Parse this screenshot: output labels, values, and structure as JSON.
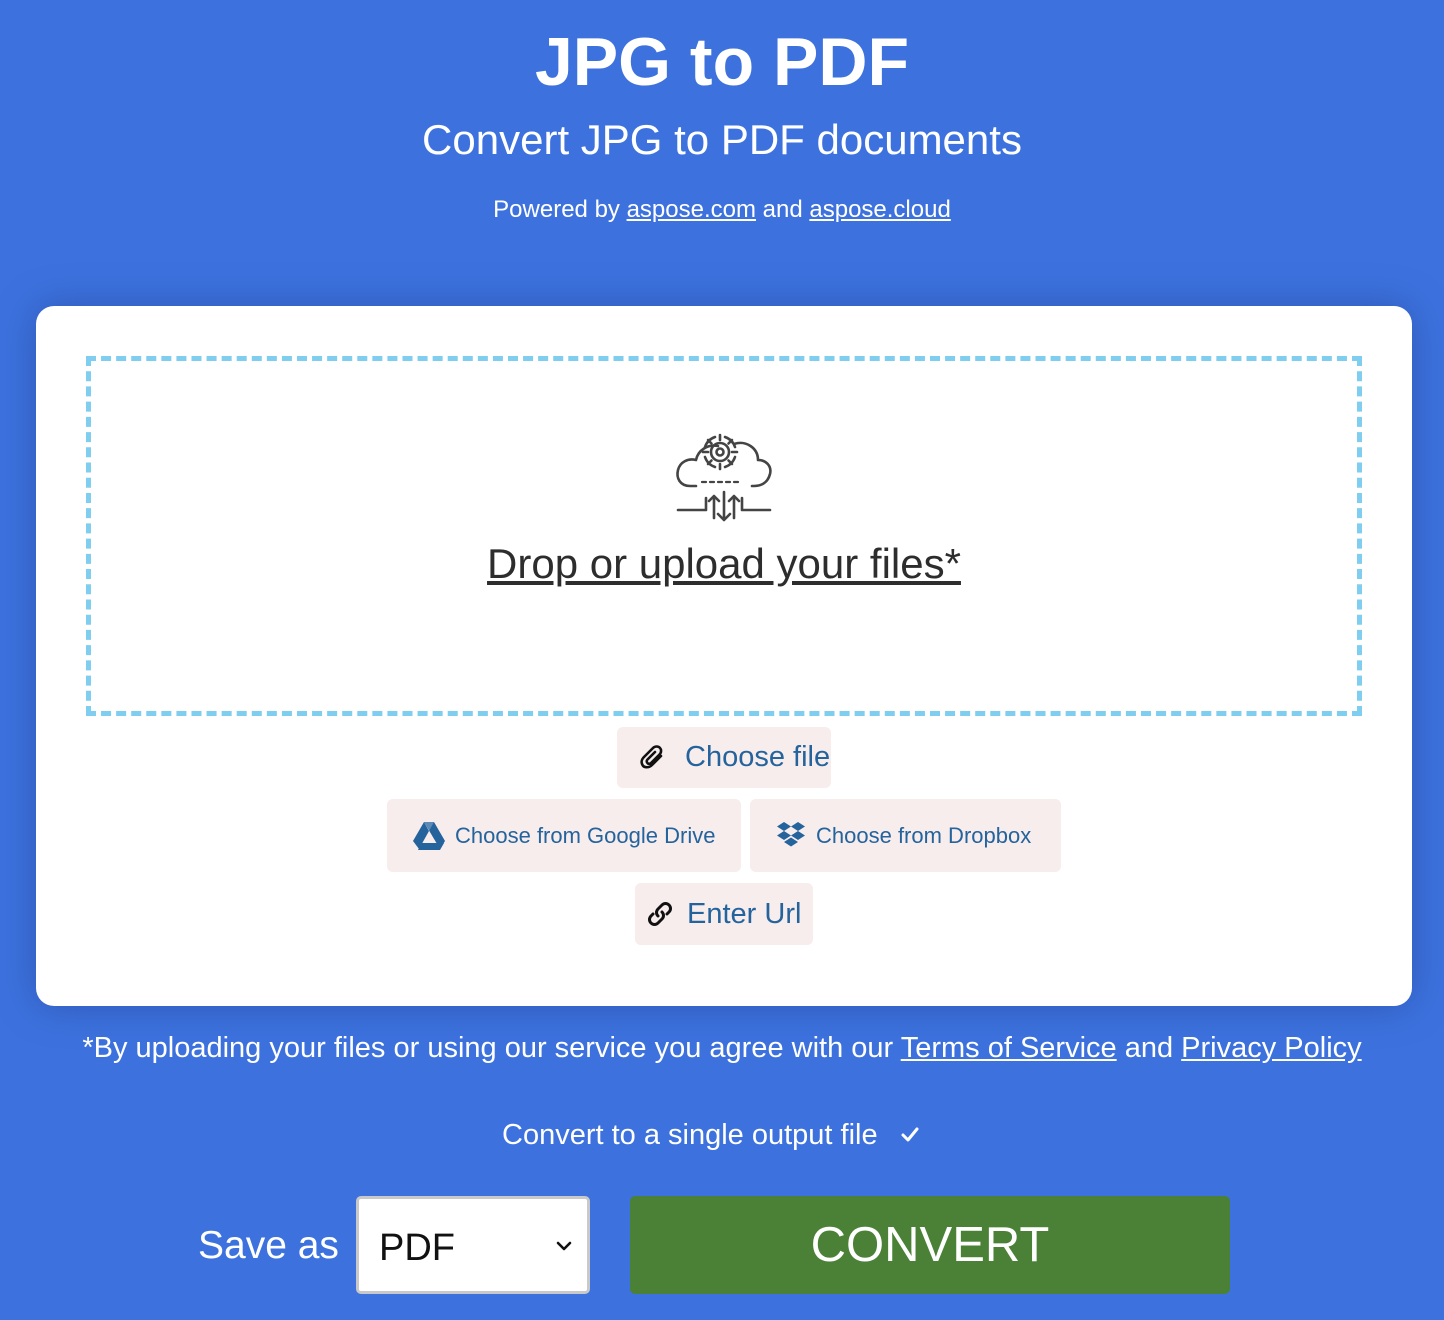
{
  "header": {
    "title": "JPG to PDF",
    "subtitle": "Convert JPG to PDF documents",
    "powered_prefix": "Powered by ",
    "link_aspose_com": "aspose.com",
    "powered_and": " and ",
    "link_aspose_cloud": "aspose.cloud"
  },
  "upload": {
    "icon": "cloud-gear-upload-icon",
    "drop_text": "Drop or upload your files*",
    "choose_file": "Choose file",
    "google_drive": "Choose from Google Drive",
    "dropbox": "Choose from Dropbox",
    "enter_url": "Enter Url"
  },
  "terms": {
    "prefix": "*By uploading your files or using our service you agree with our ",
    "tos": "Terms of Service",
    "and": " and ",
    "privacy": "Privacy Policy"
  },
  "options": {
    "single_output_label": "Convert to a single output file",
    "single_output_checked": true,
    "save_as_label": "Save as",
    "save_as_value": "PDF",
    "convert_label": "CONVERT"
  },
  "colors": {
    "background": "#3d72de",
    "dropzone_border": "#7fcdef",
    "button_bg": "#f7eded",
    "button_text": "#25639d",
    "convert_bg": "#4a8137"
  }
}
